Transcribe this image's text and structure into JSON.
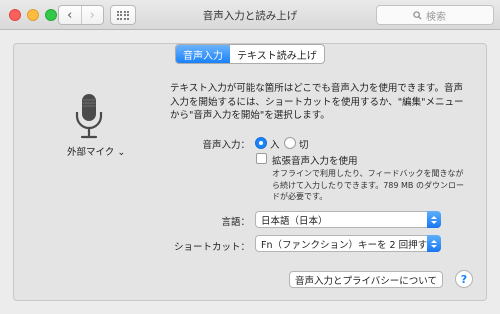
{
  "window": {
    "title": "音声入力と読み上げ",
    "search_placeholder": "検索",
    "back_glyph": "‹",
    "forward_glyph": "›"
  },
  "tabs": [
    {
      "label": "音声入力",
      "active": true
    },
    {
      "label": "テキスト読み上げ",
      "active": false
    }
  ],
  "mic": {
    "label": "外部マイク ⌄",
    "icon": "microphone-icon"
  },
  "description": "テキスト入力が可能な箇所はどこでも音声入力を使用できます。音声入力を開始するには、ショートカットを使用するか、\"編集\"メニューから\"音声入力を開始\"を選択します。",
  "dictation": {
    "label": "音声入力：",
    "on_label": "入",
    "off_label": "切",
    "selected": "入"
  },
  "enhanced": {
    "label": "拡張音声入力を使用",
    "checked": false,
    "note": "オフラインで利用したり、フィードバックを聞きながら続けて入力したりできます。789 MB のダウンロードが必要です。"
  },
  "language": {
    "label": "言語：",
    "value": "日本語（日本）"
  },
  "shortcut": {
    "label": "ショートカット：",
    "value": "Fn（ファンクション）キーを 2 回押す"
  },
  "privacy_button": "音声入力とプライバシーについて",
  "help_button": "?"
}
